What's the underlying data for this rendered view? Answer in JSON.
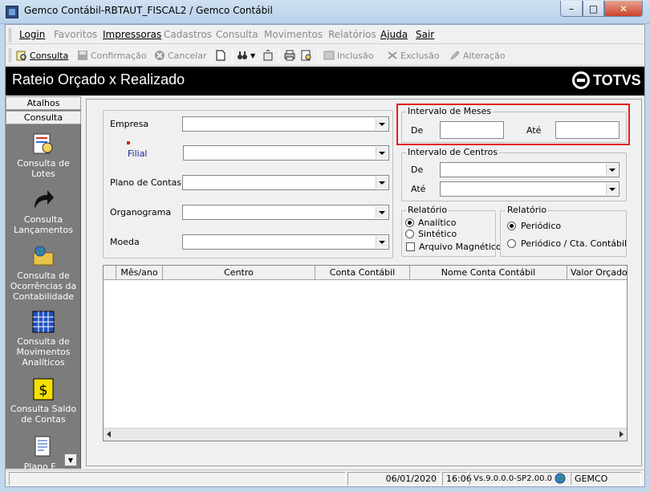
{
  "window": {
    "title": "Gemco Contábil-RBTAUT_FISCAL2 / Gemco Contábil",
    "minimize": "–",
    "maximize": "□",
    "close": "✕"
  },
  "menu": {
    "items": [
      {
        "label": "Login",
        "enabled": true
      },
      {
        "label": "Favoritos",
        "enabled": false
      },
      {
        "label": "Impressoras",
        "enabled": true
      },
      {
        "label": "Cadastros",
        "enabled": false
      },
      {
        "label": "Consulta",
        "enabled": false
      },
      {
        "label": "Movimentos",
        "enabled": false
      },
      {
        "label": "Relatórios",
        "enabled": false
      },
      {
        "label": "Ajuda",
        "enabled": true
      },
      {
        "label": "Sair",
        "enabled": true
      }
    ]
  },
  "toolbar": {
    "consulta": "Consulta",
    "confirmacao": "Confirmação",
    "cancelar": "Cancelar",
    "inclusao": "Inclusão",
    "exclusao": "Exclusão",
    "alteracao": "Alteração"
  },
  "header": {
    "title": "Rateio Orçado x Realizado",
    "brand": "TOTVS"
  },
  "sidebar": {
    "tab_atalhos": "Atalhos",
    "tab_consulta": "Consulta",
    "items": [
      {
        "label": "Consulta de Lotes",
        "icon": "document-search-icon"
      },
      {
        "label": "Consulta Lançamentos",
        "icon": "arrow-right-icon"
      },
      {
        "label": "Consulta de Ocorrências da Contabilidade",
        "icon": "folder-globe-icon"
      },
      {
        "label": "Consulta de Movimentos Analíticos",
        "icon": "grid-table-icon"
      },
      {
        "label": "Consulta Saldo de Contas",
        "icon": "money-icon"
      },
      {
        "label": "Plano F...",
        "icon": "document-icon"
      }
    ]
  },
  "form": {
    "empresa_label": "Empresa",
    "filial_label": "Filial",
    "plano_label": "Plano de Contas",
    "organograma_label": "Organograma",
    "moeda_label": "Moeda",
    "meses_group": "Intervalo de Meses",
    "meses_de": "De",
    "meses_ate": "Até",
    "centros_group": "Intervalo de Centros",
    "centros_de": "De",
    "centros_ate": "Até",
    "relatorio1_group": "Relatório",
    "analitico": "Analítico",
    "sintetico": "Sintético",
    "arquivo": "Arquivo Magnético",
    "relatorio2_group": "Relatório",
    "periodico": "Periódico",
    "periodico_cta": "Periódico / Cta. Contábil"
  },
  "grid": {
    "columns": [
      "",
      "Mês/ano",
      "Centro",
      "Conta Contábil",
      "Nome Conta Contábil",
      "Valor Orçado"
    ]
  },
  "status": {
    "date": "06/01/2020",
    "time": "16:06",
    "version": "Vs.9.0.0.0-SP2.00.0",
    "company": "GEMCO"
  },
  "colors": {
    "header_bg": "#000000",
    "sidebar_bg": "#7c7c7c",
    "highlight": "#e02020"
  }
}
